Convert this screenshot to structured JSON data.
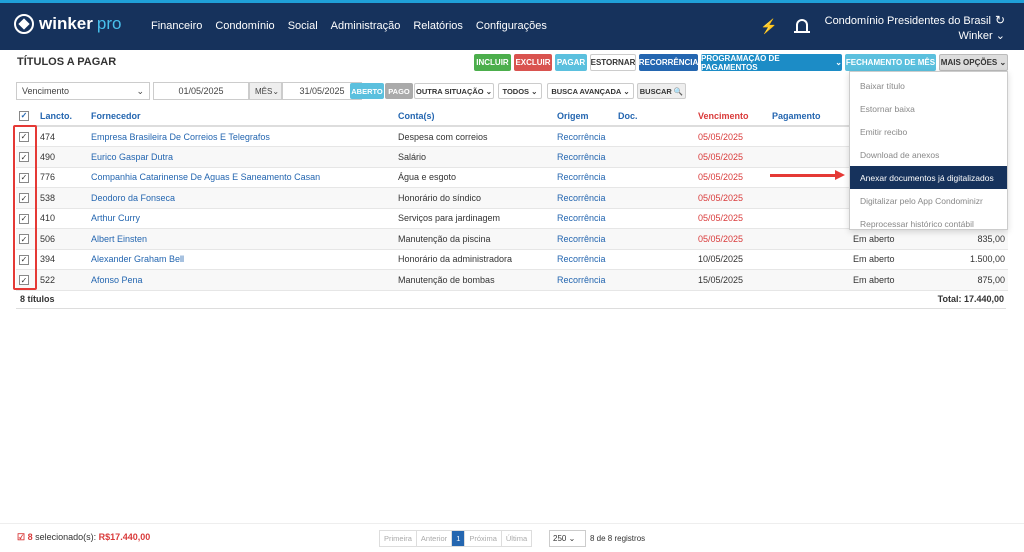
{
  "header": {
    "logo": "winker",
    "logo_suffix": "pro",
    "nav": [
      "Financeiro",
      "Condomínio",
      "Social",
      "Administração",
      "Relatórios",
      "Configurações"
    ],
    "org_name": "Condomínio Presidentes do Brasil",
    "user": "Winker"
  },
  "page_title": "TÍTULOS A PAGAR",
  "toolbar": [
    {
      "label": "INCLUIR",
      "color": "#4cae4c"
    },
    {
      "label": "EXCLUIR",
      "color": "#d9534f"
    },
    {
      "label": "PAGAR",
      "color": "#5bc0de"
    },
    {
      "label": "ESTORNAR",
      "color": "#ffffff"
    },
    {
      "label": "RECORRÊNCIA",
      "color": "#2466b0"
    },
    {
      "label": "PROGRAMAÇÃO DE PAGAMENTOS",
      "color": "#1c8cc6"
    },
    {
      "label": "FECHAMENTO DE MÊS",
      "color": "#5bc0de"
    },
    {
      "label": "MAIS OPÇÕES",
      "color": "#dddddd"
    }
  ],
  "filters": {
    "date_field": "Vencimento",
    "date_from": "01/05/2025",
    "period": "MÊS",
    "date_to": "31/05/2025",
    "status_open": "ABERTO",
    "status_paid": "PAGO",
    "other_status": "OUTRA SITUAÇÃO",
    "all": "TODOS",
    "advanced": "BUSCA AVANÇADA",
    "search": "BUSCAR"
  },
  "table": {
    "headers": [
      "Lancto.",
      "Fornecedor",
      "Conta(s)",
      "Origem",
      "Doc.",
      "Vencimento",
      "Pagamento",
      "",
      ""
    ],
    "rows": [
      {
        "id": "474",
        "supplier": "Empresa Brasileira De Correios E Telegrafos",
        "account": "Despesa com correios",
        "origin": "Recorrência",
        "doc": "",
        "due": "05/05/2025",
        "overdue": true,
        "status": "",
        "value": ""
      },
      {
        "id": "490",
        "supplier": "Eurico Gaspar Dutra",
        "account": "Salário",
        "origin": "Recorrência",
        "doc": "",
        "due": "05/05/2025",
        "overdue": true,
        "status": "",
        "value": ""
      },
      {
        "id": "776",
        "supplier": "Companhia Catarinense De Aguas E Saneamento Casan",
        "account": "Água e esgoto",
        "origin": "Recorrência",
        "doc": "",
        "due": "05/05/2025",
        "overdue": true,
        "status": "",
        "value": ""
      },
      {
        "id": "538",
        "supplier": "Deodoro da Fonseca",
        "account": "Honorário do síndico",
        "origin": "Recorrência",
        "doc": "",
        "due": "05/05/2025",
        "overdue": true,
        "status": "",
        "value": ""
      },
      {
        "id": "410",
        "supplier": "Arthur Curry",
        "account": "Serviços para jardinagem",
        "origin": "Recorrência",
        "doc": "",
        "due": "05/05/2025",
        "overdue": true,
        "status": "",
        "value": ""
      },
      {
        "id": "506",
        "supplier": "Albert Einsten",
        "account": "Manutenção da piscina",
        "origin": "Recorrência",
        "doc": "",
        "due": "05/05/2025",
        "overdue": true,
        "status": "Em aberto",
        "value": "835,00"
      },
      {
        "id": "394",
        "supplier": "Alexander Graham Bell",
        "account": "Honorário da administradora",
        "origin": "Recorrência",
        "doc": "",
        "due": "10/05/2025",
        "overdue": false,
        "status": "Em aberto",
        "value": "1.500,00"
      },
      {
        "id": "522",
        "supplier": "Afonso Pena",
        "account": "Manutenção de bombas",
        "origin": "Recorrência",
        "doc": "",
        "due": "15/05/2025",
        "overdue": false,
        "status": "Em aberto",
        "value": "875,00"
      }
    ],
    "count_label": "8 títulos",
    "total_label": "Total: 17.440,00"
  },
  "dropdown": [
    "Baixar título",
    "Estornar baixa",
    "Emitir recibo",
    "Download de anexos",
    "Anexar documentos já digitalizados",
    "Digitalizar pelo App Condominizr",
    "Reprocessar histórico contábil"
  ],
  "dropdown_active": 4,
  "footer": {
    "selected_count": "8",
    "selected_label": "selecionado(s):",
    "selected_total": "R$17.440,00",
    "pager": [
      "Primeira",
      "Anterior",
      "1",
      "Próxima",
      "Última"
    ],
    "page_size": "250",
    "records": "8 de 8 registros"
  }
}
